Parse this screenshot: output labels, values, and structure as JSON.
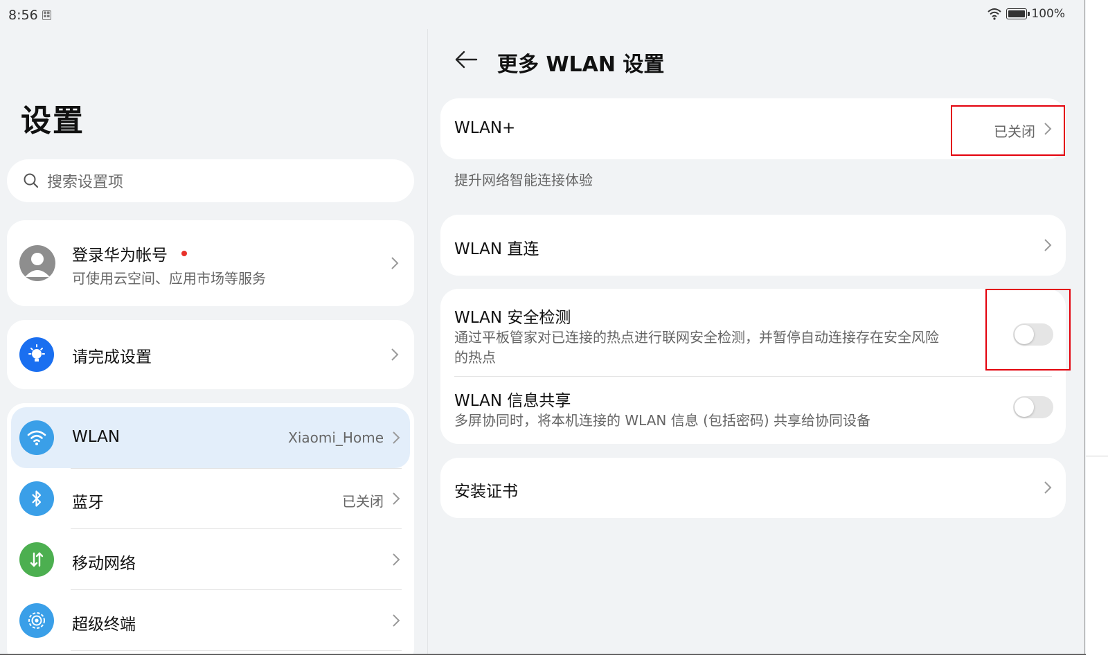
{
  "status_bar": {
    "time": "8:56",
    "battery": "100%"
  },
  "settings": {
    "title": "设置",
    "search": {
      "placeholder": "搜索设置项"
    },
    "account": {
      "title": "登录华为帐号",
      "subtitle": "可使用云空间、应用市场等服务"
    },
    "setup": {
      "label": "请完成设置"
    },
    "items": [
      {
        "label": "WLAN",
        "value": "Xiaomi_Home",
        "icon": "wifi-icon",
        "color": "#3a9fe8",
        "selected": true
      },
      {
        "label": "蓝牙",
        "value": "已关闭",
        "icon": "bluetooth-icon",
        "color": "#3a9fe8"
      },
      {
        "label": "移动网络",
        "value": "",
        "icon": "mobile-network-icon",
        "color": "#4caf50"
      },
      {
        "label": "超级终端",
        "value": "",
        "icon": "super-device-icon",
        "color": "#3a9fe8"
      }
    ]
  },
  "detail": {
    "title": "更多 WLAN 设置",
    "wlan_plus": {
      "label": "WLAN+",
      "value": "已关闭",
      "caption": "提升网络智能连接体验"
    },
    "direct": {
      "label": "WLAN 直连"
    },
    "security": {
      "label": "WLAN 安全检测",
      "line1": "通过平板管家对已连接的热点进行联网安全检测，并暂停自动连接存在安全风险",
      "line2": "的热点",
      "enabled": false
    },
    "share": {
      "label": "WLAN 信息共享",
      "desc": "多屏协同时，将本机连接的 WLAN 信息 (包括密码) 共享给协同设备",
      "enabled": false
    },
    "cert": {
      "label": "安装证书"
    }
  },
  "colors": {
    "accent": "#3a9fe8",
    "selected_bg": "#e3eefa",
    "highlight": "#e3000b",
    "background": "#f1f3f5"
  }
}
